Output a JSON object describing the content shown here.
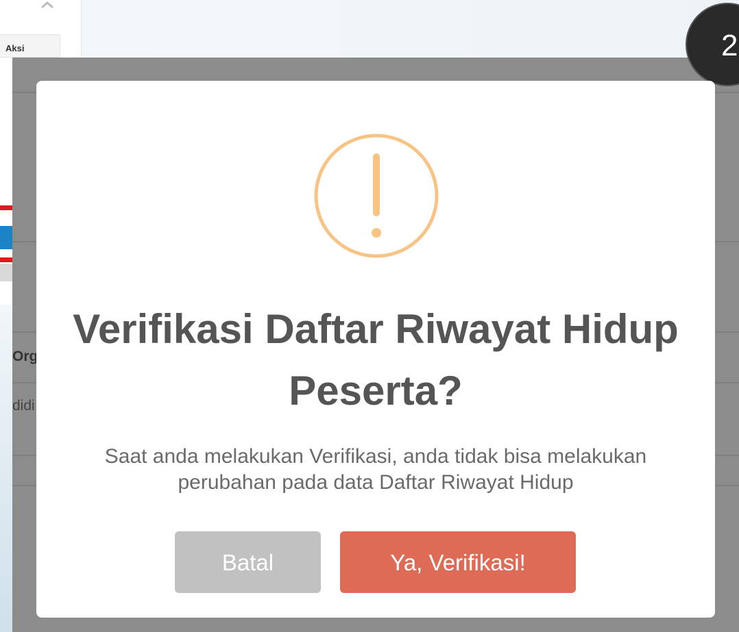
{
  "background": {
    "table_header": "Aksi",
    "partial_label_1": "Org",
    "partial_label_2": "didi"
  },
  "step_badge": "2",
  "modal": {
    "icon": "exclamation-circle-icon",
    "icon_color": "#f8bb86",
    "title_line1": "Verifikasi Daftar Riwayat Hidup",
    "title_line2": "Peserta?",
    "text_line1": "Saat anda melakukan Verifikasi, anda tidak bisa melakukan",
    "text_line2": "perubahan pada data Daftar Riwayat Hidup",
    "cancel_label": "Batal",
    "confirm_label": "Ya, Verifikasi!",
    "cancel_color": "#c1c1c1",
    "confirm_color": "#dd6b55"
  }
}
